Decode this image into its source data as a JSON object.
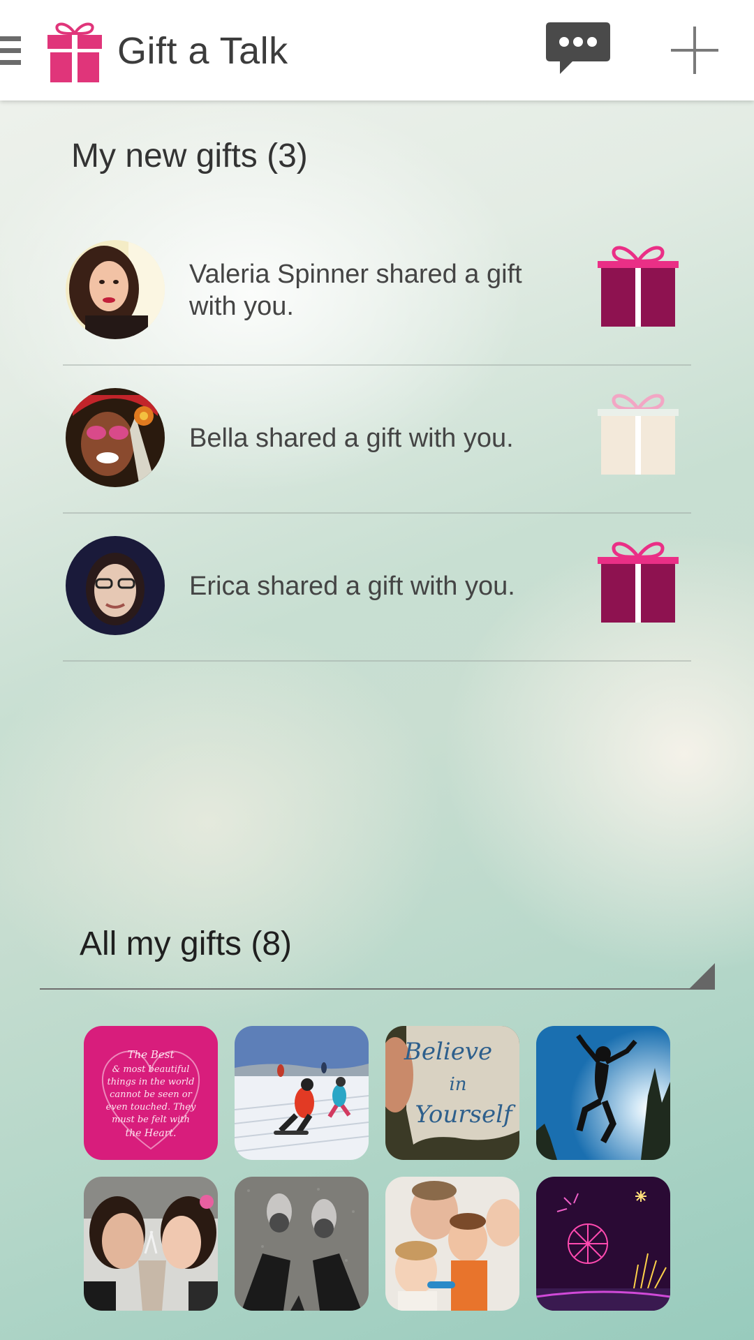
{
  "app": {
    "title": "Gift a Talk"
  },
  "new_gifts": {
    "title": "My new gifts (3)",
    "items": [
      {
        "text": "Valeria Spinner shared a gift with you.",
        "gift_state": "unopened"
      },
      {
        "text": "Bella shared a gift with you.",
        "gift_state": "opened"
      },
      {
        "text": "Erica shared a gift with you.",
        "gift_state": "unopened"
      }
    ]
  },
  "all_gifts": {
    "title": "All my gifts (8)",
    "thumbnails": [
      {
        "icon": "quote-card-image",
        "caption": "The Best & most beautiful things in the world cannot be seen or even touched. They must be felt with the Heart."
      },
      {
        "icon": "snowboarding-image"
      },
      {
        "icon": "believe-in-yourself-image",
        "caption": "Believe in Yourself"
      },
      {
        "icon": "jumping-silhouette-image"
      },
      {
        "icon": "couple-milkshake-image"
      },
      {
        "icon": "feet-sneakers-image"
      },
      {
        "icon": "family-photo-image"
      },
      {
        "icon": "fireworks-image"
      }
    ]
  },
  "colors": {
    "gift_pink": "#e0357a",
    "gift_maroon": "#8e1250",
    "gift_ribbon": "#ea2f86",
    "opened_gift": "#f3e9da"
  }
}
